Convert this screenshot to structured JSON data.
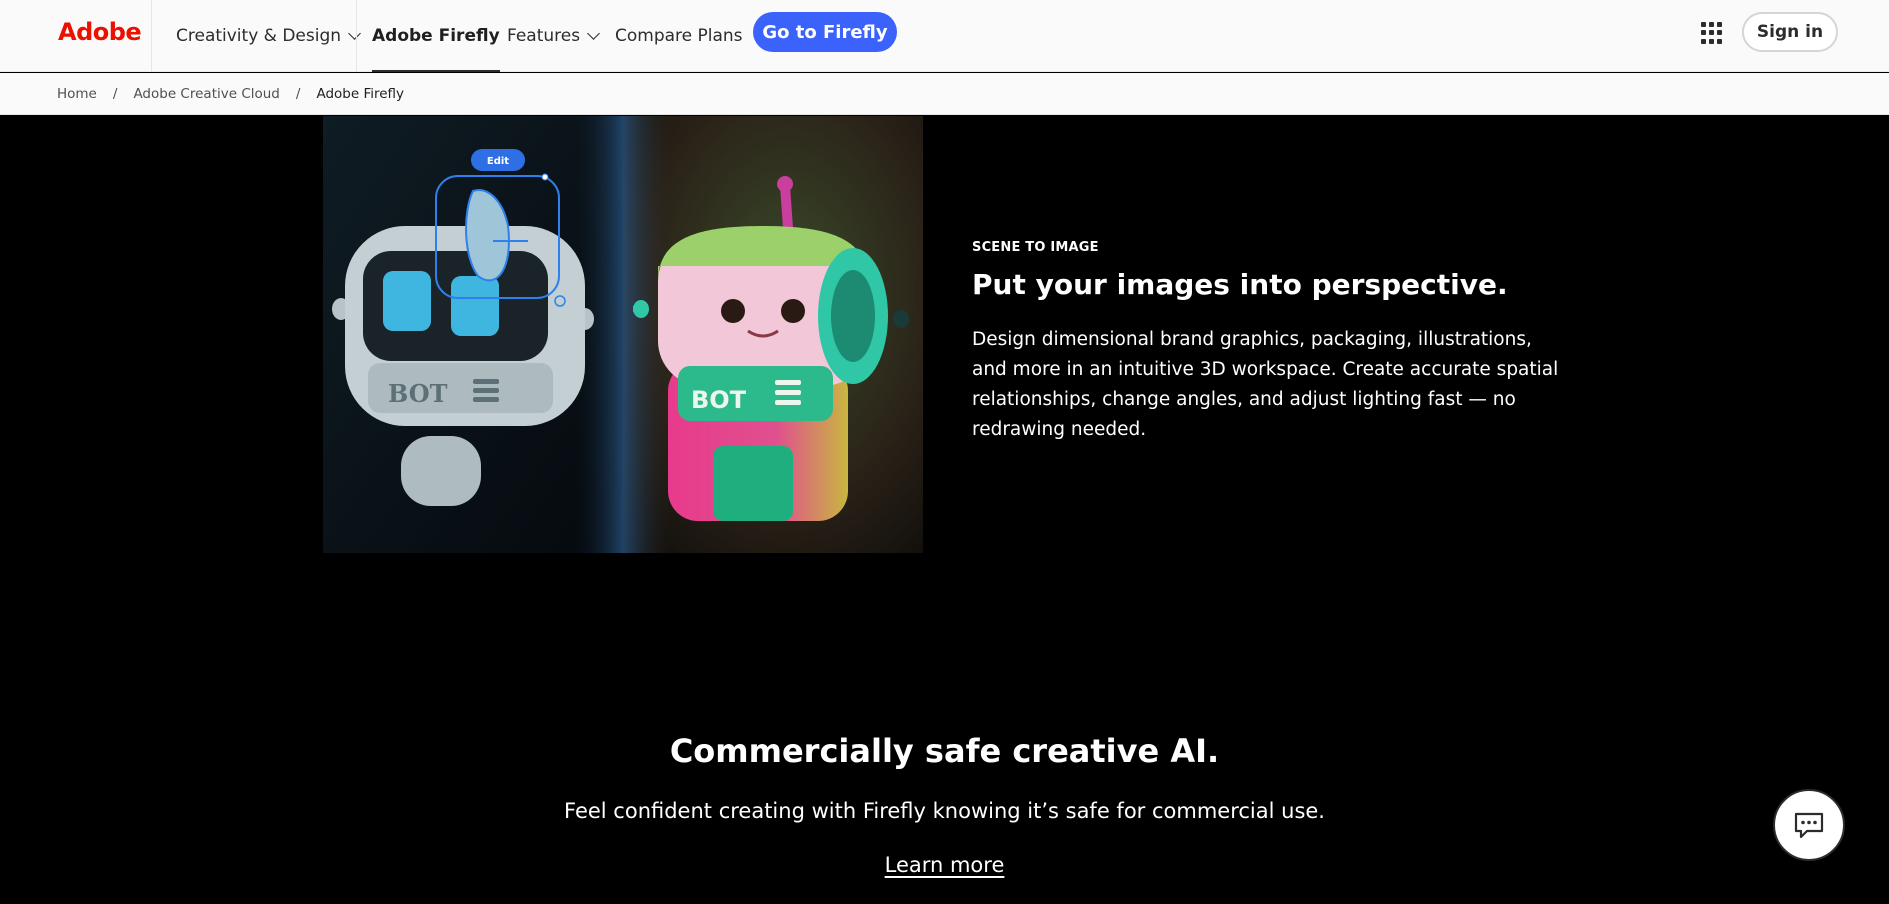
{
  "header": {
    "logo": "Adobe",
    "nav": [
      {
        "label": "Creativity & Design",
        "dropdown": true
      },
      {
        "label": "Adobe Firefly",
        "active": true
      },
      {
        "label": "Features",
        "dropdown": true
      },
      {
        "label": "Compare Plans"
      }
    ],
    "cta_label": "Go to Firefly",
    "apps_icon": "app-grid-icon",
    "signin_label": "Sign in"
  },
  "breadcrumb": [
    "Home",
    "Adobe Creative Cloud",
    "Adobe Firefly"
  ],
  "feature": {
    "image_edit_label": "Edit",
    "image_robot_text_left": "BOT",
    "image_robot_text_right": "BOT",
    "eyebrow": "SCENE TO IMAGE",
    "title": "Put your images into perspective.",
    "description": "Design dimensional brand graphics, packaging, illustrations, and more in an intuitive 3D workspace. Create accurate spatial relationships, change angles, and adjust lighting fast — no redrawing needed."
  },
  "section": {
    "title": "Commercially safe creative AI.",
    "description": "Feel confident creating with Firefly knowing it’s safe for commercial use.",
    "link_label": "Learn more"
  },
  "chat_icon": "chat-bubble-icon",
  "colors": {
    "brand_red": "#eb1000",
    "cta_blue": "#3b63fb",
    "background": "#000000"
  }
}
